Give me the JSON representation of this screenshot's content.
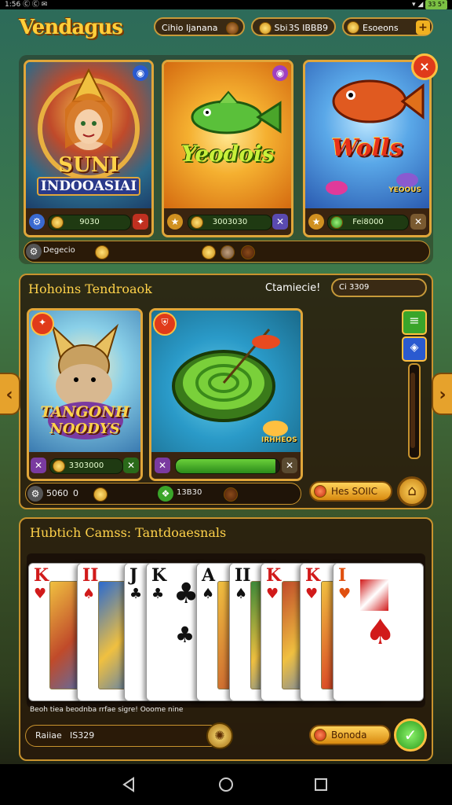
{
  "status": {
    "left": "1:56  Ⓒ Ⓒ  ✉",
    "battery": "33 5°"
  },
  "header": {
    "logo": "Vendagus",
    "pill1": "Cihio Ijanana",
    "pill2_label": "Sbi",
    "pill2_value": "3S IBBB9",
    "pill3": "Esoeons"
  },
  "featured": {
    "cards": [
      {
        "title_1": "SUNI",
        "title_2": "INDOOASIAI",
        "bar": "9030"
      },
      {
        "title_1": "Yeodois",
        "bar": "3003030"
      },
      {
        "title_1": "Wolls",
        "tag": "YEOOUS",
        "bar": "Fei8000"
      }
    ],
    "row_label": "Degecio",
    "dots": [
      "gold",
      "bronze",
      "brown"
    ]
  },
  "tournaments": {
    "title": "Hohoins Tendroaok",
    "label": "Ctamiecie!",
    "value": "Ci 3309",
    "cards": [
      {
        "title_1": "TANGONH",
        "title_2": "NOODYS",
        "bar": "3303000"
      },
      {
        "title_1": "IRHHEOS",
        "bar": ""
      }
    ],
    "row1_label": "5060",
    "row1_num": "0",
    "row2_label": "13B30",
    "action_button": "Hes SOIIC"
  },
  "cards_section": {
    "title": "Hubtich Camss: Tantdoaesnals",
    "cards": [
      {
        "rank": "K",
        "suit": "♥",
        "color": "#d11a1a"
      },
      {
        "rank": "II",
        "suit": "♠",
        "color": "#d11a1a"
      },
      {
        "rank": "J",
        "suit": "♣",
        "color": "#111111"
      },
      {
        "rank": "K",
        "suit": "♣",
        "color": "#111111"
      },
      {
        "rank": "A",
        "suit": "♠",
        "color": "#111111"
      },
      {
        "rank": "II",
        "suit": "♠",
        "color": "#111111"
      },
      {
        "rank": "K",
        "suit": "♥",
        "color": "#d11a1a"
      },
      {
        "rank": "K",
        "suit": "♥",
        "color": "#d11a1a"
      },
      {
        "rank": "I",
        "suit": "♥",
        "color": "#e05010"
      }
    ],
    "caption": "Beoh tiea beodnba rrfae sigre! Ooome nine",
    "input_label": "Raiiae",
    "input_value": "IS329",
    "button": "Bonoda"
  },
  "colors": {
    "gold": "#e0a63a",
    "panel": "#28180a",
    "green": "#3aa52a"
  }
}
